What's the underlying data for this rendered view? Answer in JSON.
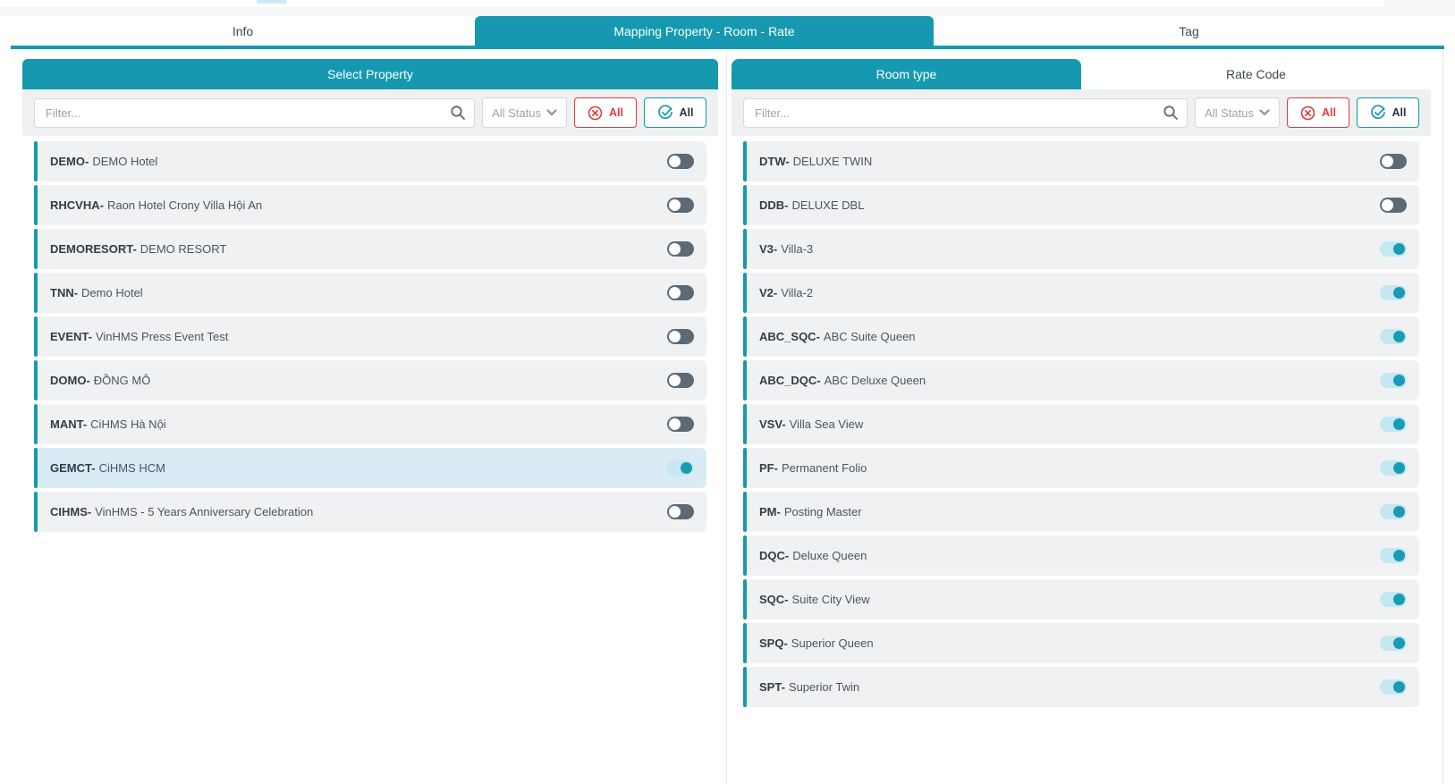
{
  "colors": {
    "primary_teal": "#1699b0",
    "danger_red": "#e5393c",
    "row_bg": "#f0f1f3",
    "selected_row_bg": "#d9ebf5",
    "toggle_off_track": "#5c6a76",
    "toggle_on_track": "#c5e7f2",
    "toggle_on_knob": "#189cb5"
  },
  "main_tabs": [
    {
      "label": "Info",
      "active": false
    },
    {
      "label": "Mapping Property - Room - Rate",
      "active": true
    },
    {
      "label": "Tag",
      "active": false
    }
  ],
  "left_panel": {
    "header": "Select Property",
    "filter": {
      "placeholder": "Filter...",
      "status_label": "All Status",
      "deselect_all_label": "All",
      "select_all_label": "All"
    },
    "items": [
      {
        "code": "DEMO-",
        "name": "DEMO Hotel",
        "on": false,
        "selected": false
      },
      {
        "code": "RHCVHA-",
        "name": "Raon Hotel Crony Villa Hội An",
        "on": false,
        "selected": false
      },
      {
        "code": "DEMORESORT-",
        "name": "DEMO RESORT",
        "on": false,
        "selected": false
      },
      {
        "code": "TNN-",
        "name": "Demo Hotel",
        "on": false,
        "selected": false
      },
      {
        "code": "EVENT-",
        "name": "VinHMS Press Event Test",
        "on": false,
        "selected": false
      },
      {
        "code": "DOMO-",
        "name": "ĐỒNG MÔ",
        "on": false,
        "selected": false
      },
      {
        "code": "MANT-",
        "name": "CiHMS Hà Nội",
        "on": false,
        "selected": false
      },
      {
        "code": "GEMCT-",
        "name": "CiHMS HCM",
        "on": true,
        "selected": true
      },
      {
        "code": "CIHMS-",
        "name": "VinHMS - 5 Years Anniversary Celebration",
        "on": false,
        "selected": false
      }
    ]
  },
  "right_panel": {
    "tabs": [
      {
        "label": "Room type",
        "active": true
      },
      {
        "label": "Rate Code",
        "active": false
      }
    ],
    "filter": {
      "placeholder": "Filter...",
      "status_label": "All Status",
      "deselect_all_label": "All",
      "select_all_label": "All"
    },
    "items": [
      {
        "code": "DTW-",
        "name": "DELUXE TWIN",
        "on": false,
        "selected": false
      },
      {
        "code": "DDB-",
        "name": "DELUXE DBL",
        "on": false,
        "selected": false
      },
      {
        "code": "V3-",
        "name": "Villa-3",
        "on": true,
        "selected": false
      },
      {
        "code": "V2-",
        "name": "Villa-2",
        "on": true,
        "selected": false
      },
      {
        "code": "ABC_SQC-",
        "name": "ABC Suite Queen",
        "on": true,
        "selected": false
      },
      {
        "code": "ABC_DQC-",
        "name": "ABC Deluxe Queen",
        "on": true,
        "selected": false
      },
      {
        "code": "VSV-",
        "name": "Villa Sea View",
        "on": true,
        "selected": false
      },
      {
        "code": "PF-",
        "name": "Permanent Folio",
        "on": true,
        "selected": false
      },
      {
        "code": "PM-",
        "name": "Posting Master",
        "on": true,
        "selected": false
      },
      {
        "code": "DQC-",
        "name": "Deluxe Queen",
        "on": true,
        "selected": false
      },
      {
        "code": "SQC-",
        "name": "Suite City View",
        "on": true,
        "selected": false
      },
      {
        "code": "SPQ-",
        "name": "Superior Queen",
        "on": true,
        "selected": false
      },
      {
        "code": "SPT-",
        "name": "Superior Twin",
        "on": true,
        "selected": false
      }
    ]
  }
}
